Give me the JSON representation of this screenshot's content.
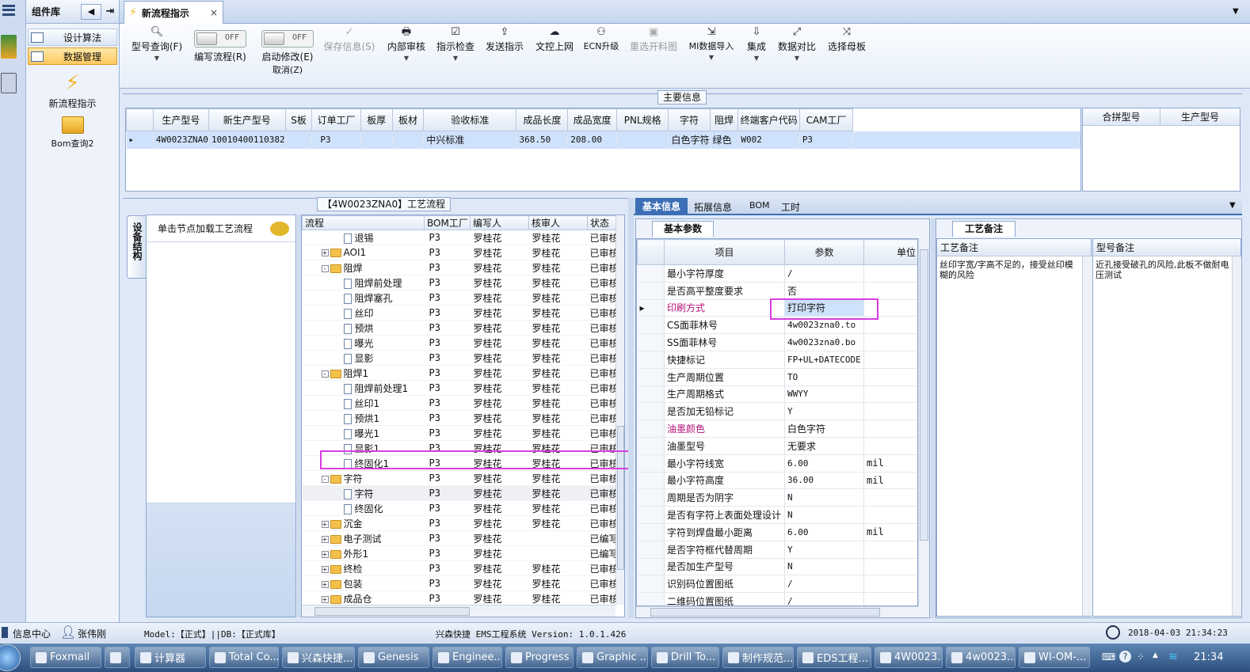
{
  "sidebar": {
    "title": "组件库",
    "items": [
      {
        "label": "设计算法",
        "selected": false
      },
      {
        "label": "数据管理",
        "selected": true
      }
    ],
    "big_items": [
      {
        "label": "新流程指示",
        "icon": "lightning-icon"
      },
      {
        "label": "Bom查询2",
        "icon": "folder-open-icon"
      }
    ]
  },
  "tabs": [
    {
      "label": "新流程指示",
      "close": "×"
    }
  ],
  "toolbar": {
    "model_query": "型号查询(F)",
    "edit_flow": "编写流程(R)",
    "edit_flow_toggle": "OFF",
    "enable_modify": "启动修改(E)",
    "enable_modify_toggle": "OFF",
    "cancel": "取消(Z)",
    "save_info": "保存信息(S)",
    "internal_review": "内部审核",
    "instruction_check": "指示检查",
    "send_instruction": "发送指示",
    "doc_upload": "文控上网",
    "ecn_upgrade": "ECN升级",
    "reselect_material": "重选开料图",
    "mi_import": "MI数据导入",
    "assemble": "集成",
    "data_compare": "数据对比",
    "select_master": "选择母板"
  },
  "main_info": {
    "legend": "主要信息",
    "columns": [
      "生产型号",
      "新生产型号",
      "S板",
      "订单工厂",
      "板厚",
      "板材",
      "验收标准",
      "成品长度",
      "成品宽度",
      "PNL规格",
      "字符",
      "阻焊",
      "终端客户代码",
      "CAM工厂"
    ],
    "rows": [
      [
        "4W0023ZNA0",
        "10010400110382",
        "",
        "P3",
        "",
        "",
        "中兴标准",
        "368.50",
        "208.00",
        "",
        "白色字符",
        "绿色",
        "W002",
        "P3"
      ]
    ],
    "side_columns": [
      "合拼型号",
      "生产型号"
    ]
  },
  "flow": {
    "legend": "【4W0023ZNA0】工艺流程",
    "vertical_tab": "设备结构",
    "hint": "单击节点加载工艺流程",
    "columns": [
      "流程",
      "BOM工厂",
      "编写人",
      "核审人",
      "状态"
    ],
    "rows": [
      {
        "name": "退锡",
        "level": 2,
        "kind": "doc",
        "bom": "P3",
        "writer": "罗桂花",
        "reviewer": "罗桂花",
        "status": "已审核"
      },
      {
        "name": "AOI1",
        "level": 1,
        "kind": "folder",
        "expand": "+",
        "bom": "P3",
        "writer": "罗桂花",
        "reviewer": "罗桂花",
        "status": "已审核"
      },
      {
        "name": "阻焊",
        "level": 1,
        "kind": "folder",
        "expand": "-",
        "bom": "P3",
        "writer": "罗桂花",
        "reviewer": "罗桂花",
        "status": "已审核"
      },
      {
        "name": "阻焊前处理",
        "level": 2,
        "kind": "doc",
        "bom": "P3",
        "writer": "罗桂花",
        "reviewer": "罗桂花",
        "status": "已审核"
      },
      {
        "name": "阻焊塞孔",
        "level": 2,
        "kind": "doc",
        "bom": "P3",
        "writer": "罗桂花",
        "reviewer": "罗桂花",
        "status": "已审核"
      },
      {
        "name": "丝印",
        "level": 2,
        "kind": "doc",
        "bom": "P3",
        "writer": "罗桂花",
        "reviewer": "罗桂花",
        "status": "已审核"
      },
      {
        "name": "预烘",
        "level": 2,
        "kind": "doc",
        "bom": "P3",
        "writer": "罗桂花",
        "reviewer": "罗桂花",
        "status": "已审核"
      },
      {
        "name": "曝光",
        "level": 2,
        "kind": "doc",
        "bom": "P3",
        "writer": "罗桂花",
        "reviewer": "罗桂花",
        "status": "已审核"
      },
      {
        "name": "显影",
        "level": 2,
        "kind": "doc",
        "bom": "P3",
        "writer": "罗桂花",
        "reviewer": "罗桂花",
        "status": "已审核"
      },
      {
        "name": "阻焊1",
        "level": 1,
        "kind": "folder",
        "expand": "-",
        "bom": "P3",
        "writer": "罗桂花",
        "reviewer": "罗桂花",
        "status": "已审核"
      },
      {
        "name": "阻焊前处理1",
        "level": 2,
        "kind": "doc",
        "bom": "P3",
        "writer": "罗桂花",
        "reviewer": "罗桂花",
        "status": "已审核"
      },
      {
        "name": "丝印1",
        "level": 2,
        "kind": "doc",
        "bom": "P3",
        "writer": "罗桂花",
        "reviewer": "罗桂花",
        "status": "已审核"
      },
      {
        "name": "预烘1",
        "level": 2,
        "kind": "doc",
        "bom": "P3",
        "writer": "罗桂花",
        "reviewer": "罗桂花",
        "status": "已审核"
      },
      {
        "name": "曝光1",
        "level": 2,
        "kind": "doc",
        "bom": "P3",
        "writer": "罗桂花",
        "reviewer": "罗桂花",
        "status": "已审核"
      },
      {
        "name": "显影1",
        "level": 2,
        "kind": "doc",
        "bom": "P3",
        "writer": "罗桂花",
        "reviewer": "罗桂花",
        "status": "已审核"
      },
      {
        "name": "终固化1",
        "level": 2,
        "kind": "doc",
        "bom": "P3",
        "writer": "罗桂花",
        "reviewer": "罗桂花",
        "status": "已审核"
      },
      {
        "name": "字符",
        "level": 1,
        "kind": "folder",
        "expand": "-",
        "bom": "P3",
        "writer": "罗桂花",
        "reviewer": "罗桂花",
        "status": "已审核"
      },
      {
        "name": "字符",
        "level": 2,
        "kind": "doc",
        "bom": "P3",
        "writer": "罗桂花",
        "reviewer": "罗桂花",
        "status": "已审核"
      },
      {
        "name": "终固化",
        "level": 2,
        "kind": "doc",
        "bom": "P3",
        "writer": "罗桂花",
        "reviewer": "罗桂花",
        "status": "已审核"
      },
      {
        "name": "沉金",
        "level": 1,
        "kind": "folder",
        "expand": "+",
        "bom": "P3",
        "writer": "罗桂花",
        "reviewer": "罗桂花",
        "status": "已审核"
      },
      {
        "name": "电子测试",
        "level": 1,
        "kind": "folder",
        "expand": "+",
        "bom": "P3",
        "writer": "罗桂花",
        "reviewer": "",
        "status": "已编写"
      },
      {
        "name": "外形1",
        "level": 1,
        "kind": "folder",
        "expand": "+",
        "bom": "P3",
        "writer": "罗桂花",
        "reviewer": "",
        "status": "已编写"
      },
      {
        "name": "终检",
        "level": 1,
        "kind": "folder",
        "expand": "+",
        "bom": "P3",
        "writer": "罗桂花",
        "reviewer": "罗桂花",
        "status": "已审核"
      },
      {
        "name": "包装",
        "level": 1,
        "kind": "folder",
        "expand": "+",
        "bom": "P3",
        "writer": "罗桂花",
        "reviewer": "罗桂花",
        "status": "已审核"
      },
      {
        "name": "成品仓",
        "level": 1,
        "kind": "folder",
        "expand": "+",
        "bom": "P3",
        "writer": "罗桂花",
        "reviewer": "罗桂花",
        "status": "已审核"
      }
    ]
  },
  "detail_tabs": [
    "基本信息",
    "拓展信息",
    "BOM",
    "工时"
  ],
  "basic_params": {
    "tab": "基本参数",
    "columns": [
      "项目",
      "参数",
      "单位"
    ],
    "rows": [
      {
        "item": "最小字符厚度",
        "value": "/",
        "unit": "",
        "pink": false
      },
      {
        "item": "是否高平整度要求",
        "value": "否",
        "unit": "",
        "pink": false
      },
      {
        "item": "印刷方式",
        "value": "打印字符",
        "unit": "",
        "pink": true
      },
      {
        "item": "CS面菲林号",
        "value": "4w0023zna0.to",
        "unit": "",
        "pink": false
      },
      {
        "item": "SS面菲林号",
        "value": "4w0023zna0.bo",
        "unit": "",
        "pink": false
      },
      {
        "item": "快捷标记",
        "value": "FP+UL+DATECODE",
        "unit": "",
        "pink": false
      },
      {
        "item": "生产周期位置",
        "value": "TO",
        "unit": "",
        "pink": false
      },
      {
        "item": "生产周期格式",
        "value": "WWYY",
        "unit": "",
        "pink": false
      },
      {
        "item": "是否加无铅标记",
        "value": "Y",
        "unit": "",
        "pink": false
      },
      {
        "item": "油墨颜色",
        "value": "白色字符",
        "unit": "",
        "pink": true
      },
      {
        "item": "油墨型号",
        "value": "无要求",
        "unit": "",
        "pink": false
      },
      {
        "item": "最小字符线宽",
        "value": "6.00",
        "unit": "mil",
        "pink": false
      },
      {
        "item": "最小字符高度",
        "value": "36.00",
        "unit": "mil",
        "pink": false
      },
      {
        "item": "周期是否为阴字",
        "value": "N",
        "unit": "",
        "pink": false
      },
      {
        "item": "是否有字符上表面处理设计",
        "value": "N",
        "unit": "",
        "pink": false
      },
      {
        "item": "字符到焊盘最小距离",
        "value": "6.00",
        "unit": "mil",
        "pink": false
      },
      {
        "item": "是否字符框代替周期",
        "value": "Y",
        "unit": "",
        "pink": false
      },
      {
        "item": "是否加生产型号",
        "value": "N",
        "unit": "",
        "pink": false
      },
      {
        "item": "识别码位置图纸",
        "value": "/",
        "unit": "",
        "pink": false
      },
      {
        "item": "二维码位置图纸",
        "value": "/",
        "unit": "",
        "pink": false
      }
    ]
  },
  "process_notes": {
    "tab": "工艺备注",
    "col1": "工艺备注",
    "col2": "型号备注",
    "text1": "丝印字宽/字高不足的，接受丝印模糊的风险",
    "text2": "近孔接受破孔的风险,此板不做耐电压测试"
  },
  "status_bar": {
    "info_center": "信息中心",
    "user": "张伟刚",
    "model_db": "Model:【正式】||DB:【正式库】",
    "system": "兴森快捷 EMS工程系统 Version: 1.0.1.426",
    "datetime": "2018-04-03 21:34:23"
  },
  "taskbar": {
    "items": [
      "Foxmail",
      "",
      "计算器",
      "Total Co...",
      "兴森快捷...",
      "Genesis",
      "Enginee...",
      "Progress",
      "Graphic ...",
      "Drill To...",
      "制作规范...",
      "EDS工程...",
      "4W0023...",
      "4w0023...",
      "WI-OM-..."
    ],
    "clock": "21:34"
  }
}
